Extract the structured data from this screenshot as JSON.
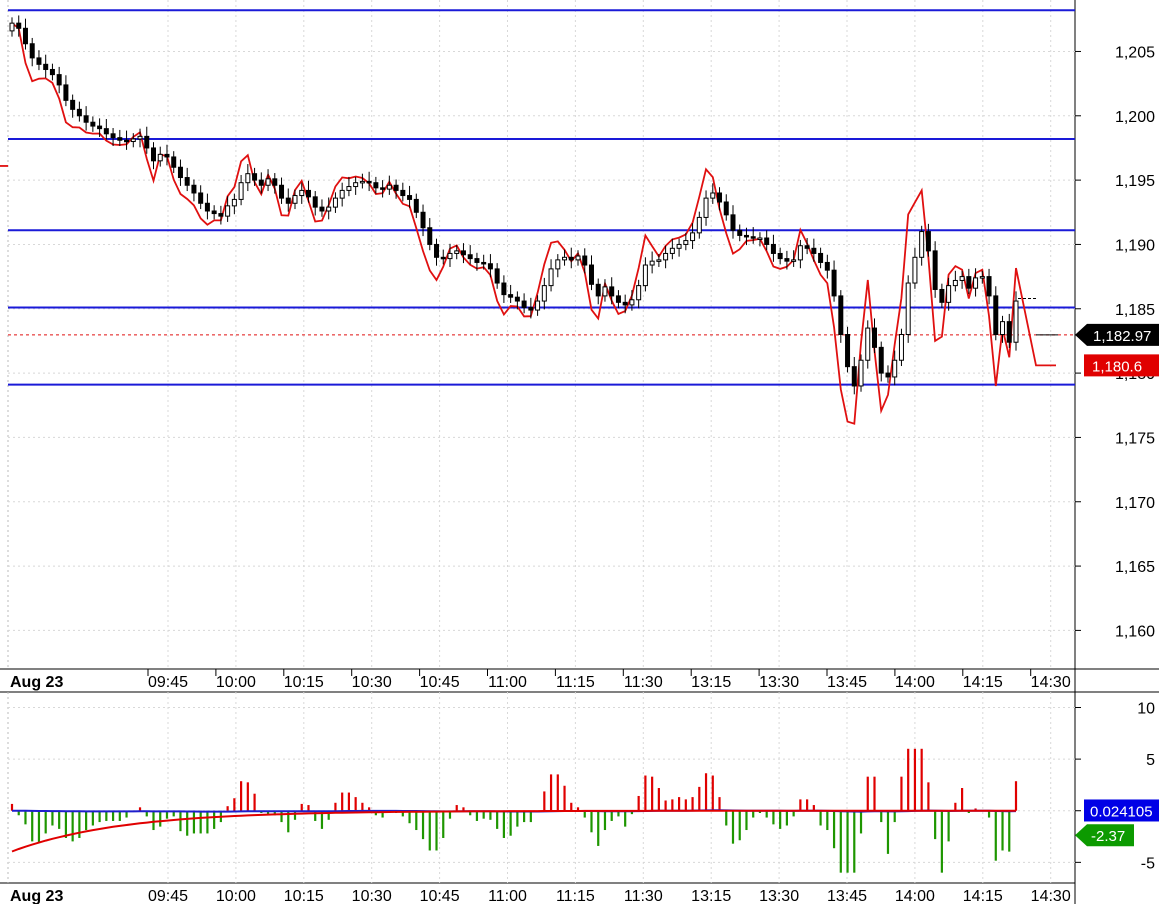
{
  "chart_data": [
    {
      "type": "candlestick",
      "ylim": [
        1157,
        1209
      ],
      "yticks": [
        1160,
        1165,
        1170,
        1175,
        1180,
        1185,
        1190,
        1195,
        1200,
        1205
      ],
      "ytick_labels": [
        "1,160",
        "1,165",
        "1,170",
        "1,175",
        "1,180",
        "1,185",
        "1,190",
        "1,195",
        "1,200",
        "1,205"
      ],
      "date_label": "Aug 23",
      "xtick_labels": [
        "09:45",
        "10:00",
        "10:15",
        "10:30",
        "10:45",
        "11:00",
        "11:15",
        "11:30",
        "13:15",
        "13:30",
        "13:45",
        "14:00",
        "14:15",
        "14:30"
      ],
      "horizontal_levels": [
        1208.2,
        1198.2,
        1191.1,
        1185.1,
        1179.1
      ],
      "last_price_level": 1182.97,
      "price_badge": "1,182.97",
      "ma_badge": "1,180.6",
      "ma_badge_value": 1180.6,
      "close_prices": [
        1207.2,
        1206.8,
        1205.6,
        1204.5,
        1204.0,
        1203.6,
        1203.2,
        1202.4,
        1201.2,
        1200.5,
        1200.0,
        1199.5,
        1199.2,
        1199.0,
        1198.6,
        1198.3,
        1198.1,
        1198.0,
        1198.2,
        1198.4,
        1197.5,
        1196.5,
        1197.0,
        1196.8,
        1196.0,
        1195.2,
        1194.6,
        1194.0,
        1193.2,
        1192.6,
        1192.4,
        1192.2,
        1193.0,
        1193.5,
        1194.8,
        1195.5,
        1195.0,
        1194.6,
        1195.1,
        1194.6,
        1193.6,
        1193.2,
        1193.8,
        1194.2,
        1193.7,
        1192.9,
        1192.6,
        1192.9,
        1193.6,
        1194.2,
        1194.5,
        1194.8,
        1194.9,
        1194.8,
        1194.4,
        1194.3,
        1194.6,
        1194.2,
        1193.8,
        1193.5,
        1192.5,
        1191.3,
        1190.0,
        1189.0,
        1188.9,
        1189.3,
        1189.5,
        1189.2,
        1188.9,
        1188.6,
        1188.5,
        1188.1,
        1187.0,
        1186.1,
        1185.9,
        1185.6,
        1185.1,
        1184.9,
        1185.6,
        1186.8,
        1188.1,
        1188.8,
        1189.0,
        1188.8,
        1189.1,
        1188.4,
        1186.9,
        1186.0,
        1186.7,
        1186.0,
        1185.5,
        1185.3,
        1185.7,
        1186.8,
        1188.4,
        1188.7,
        1188.8,
        1189.3,
        1189.7,
        1190.0,
        1190.3,
        1190.9,
        1192.1,
        1193.6,
        1194.0,
        1193.3,
        1192.3,
        1191.1,
        1190.7,
        1190.6,
        1190.5,
        1190.5,
        1190.0,
        1189.3,
        1188.9,
        1188.7,
        1188.8,
        1189.9,
        1189.7,
        1189.3,
        1188.6,
        1188.0,
        1186.0,
        1183.0,
        1180.5,
        1179.0,
        1181.0,
        1183.5,
        1182.0,
        1180.0,
        1179.7,
        1181.0,
        1183.0,
        1187.0,
        1189.0,
        1191.0,
        1189.5,
        1186.5,
        1185.5,
        1186.8,
        1187.2,
        1187.5,
        1186.6,
        1187.4,
        1187.5,
        1186.0,
        1183.0,
        1184.0,
        1182.4,
        1185.6
      ]
    },
    {
      "type": "bar",
      "ylim": [
        -7,
        11.5
      ],
      "yticks": [
        -5,
        0,
        5,
        10
      ],
      "ytick_labels": [
        "-5",
        "0",
        "5",
        "10"
      ],
      "date_label": "Aug 23",
      "xtick_labels": [
        "09:45",
        "10:00",
        "10:15",
        "10:30",
        "10:45",
        "11:00",
        "11:15",
        "11:30",
        "13:15",
        "13:30",
        "13:45",
        "14:00",
        "14:15",
        "14:30"
      ],
      "signal_badge": "0.024105",
      "signal_badge_value": 0.024105,
      "hist_badge": "-2.37",
      "hist_badge_value": -2.37,
      "colors": {
        "positive": "#e00000",
        "negative": "#1e9600",
        "signal": "#1e1ecc",
        "fast": "#e00000"
      }
    }
  ],
  "colors": {
    "level_line": "#1a1ad8",
    "ma_line": "#e01010",
    "price_dashed": "#e01010",
    "badge_dark": "#000000",
    "badge_red": "#e00000",
    "badge_blue": "#0000e6",
    "badge_green": "#0c9a00"
  }
}
